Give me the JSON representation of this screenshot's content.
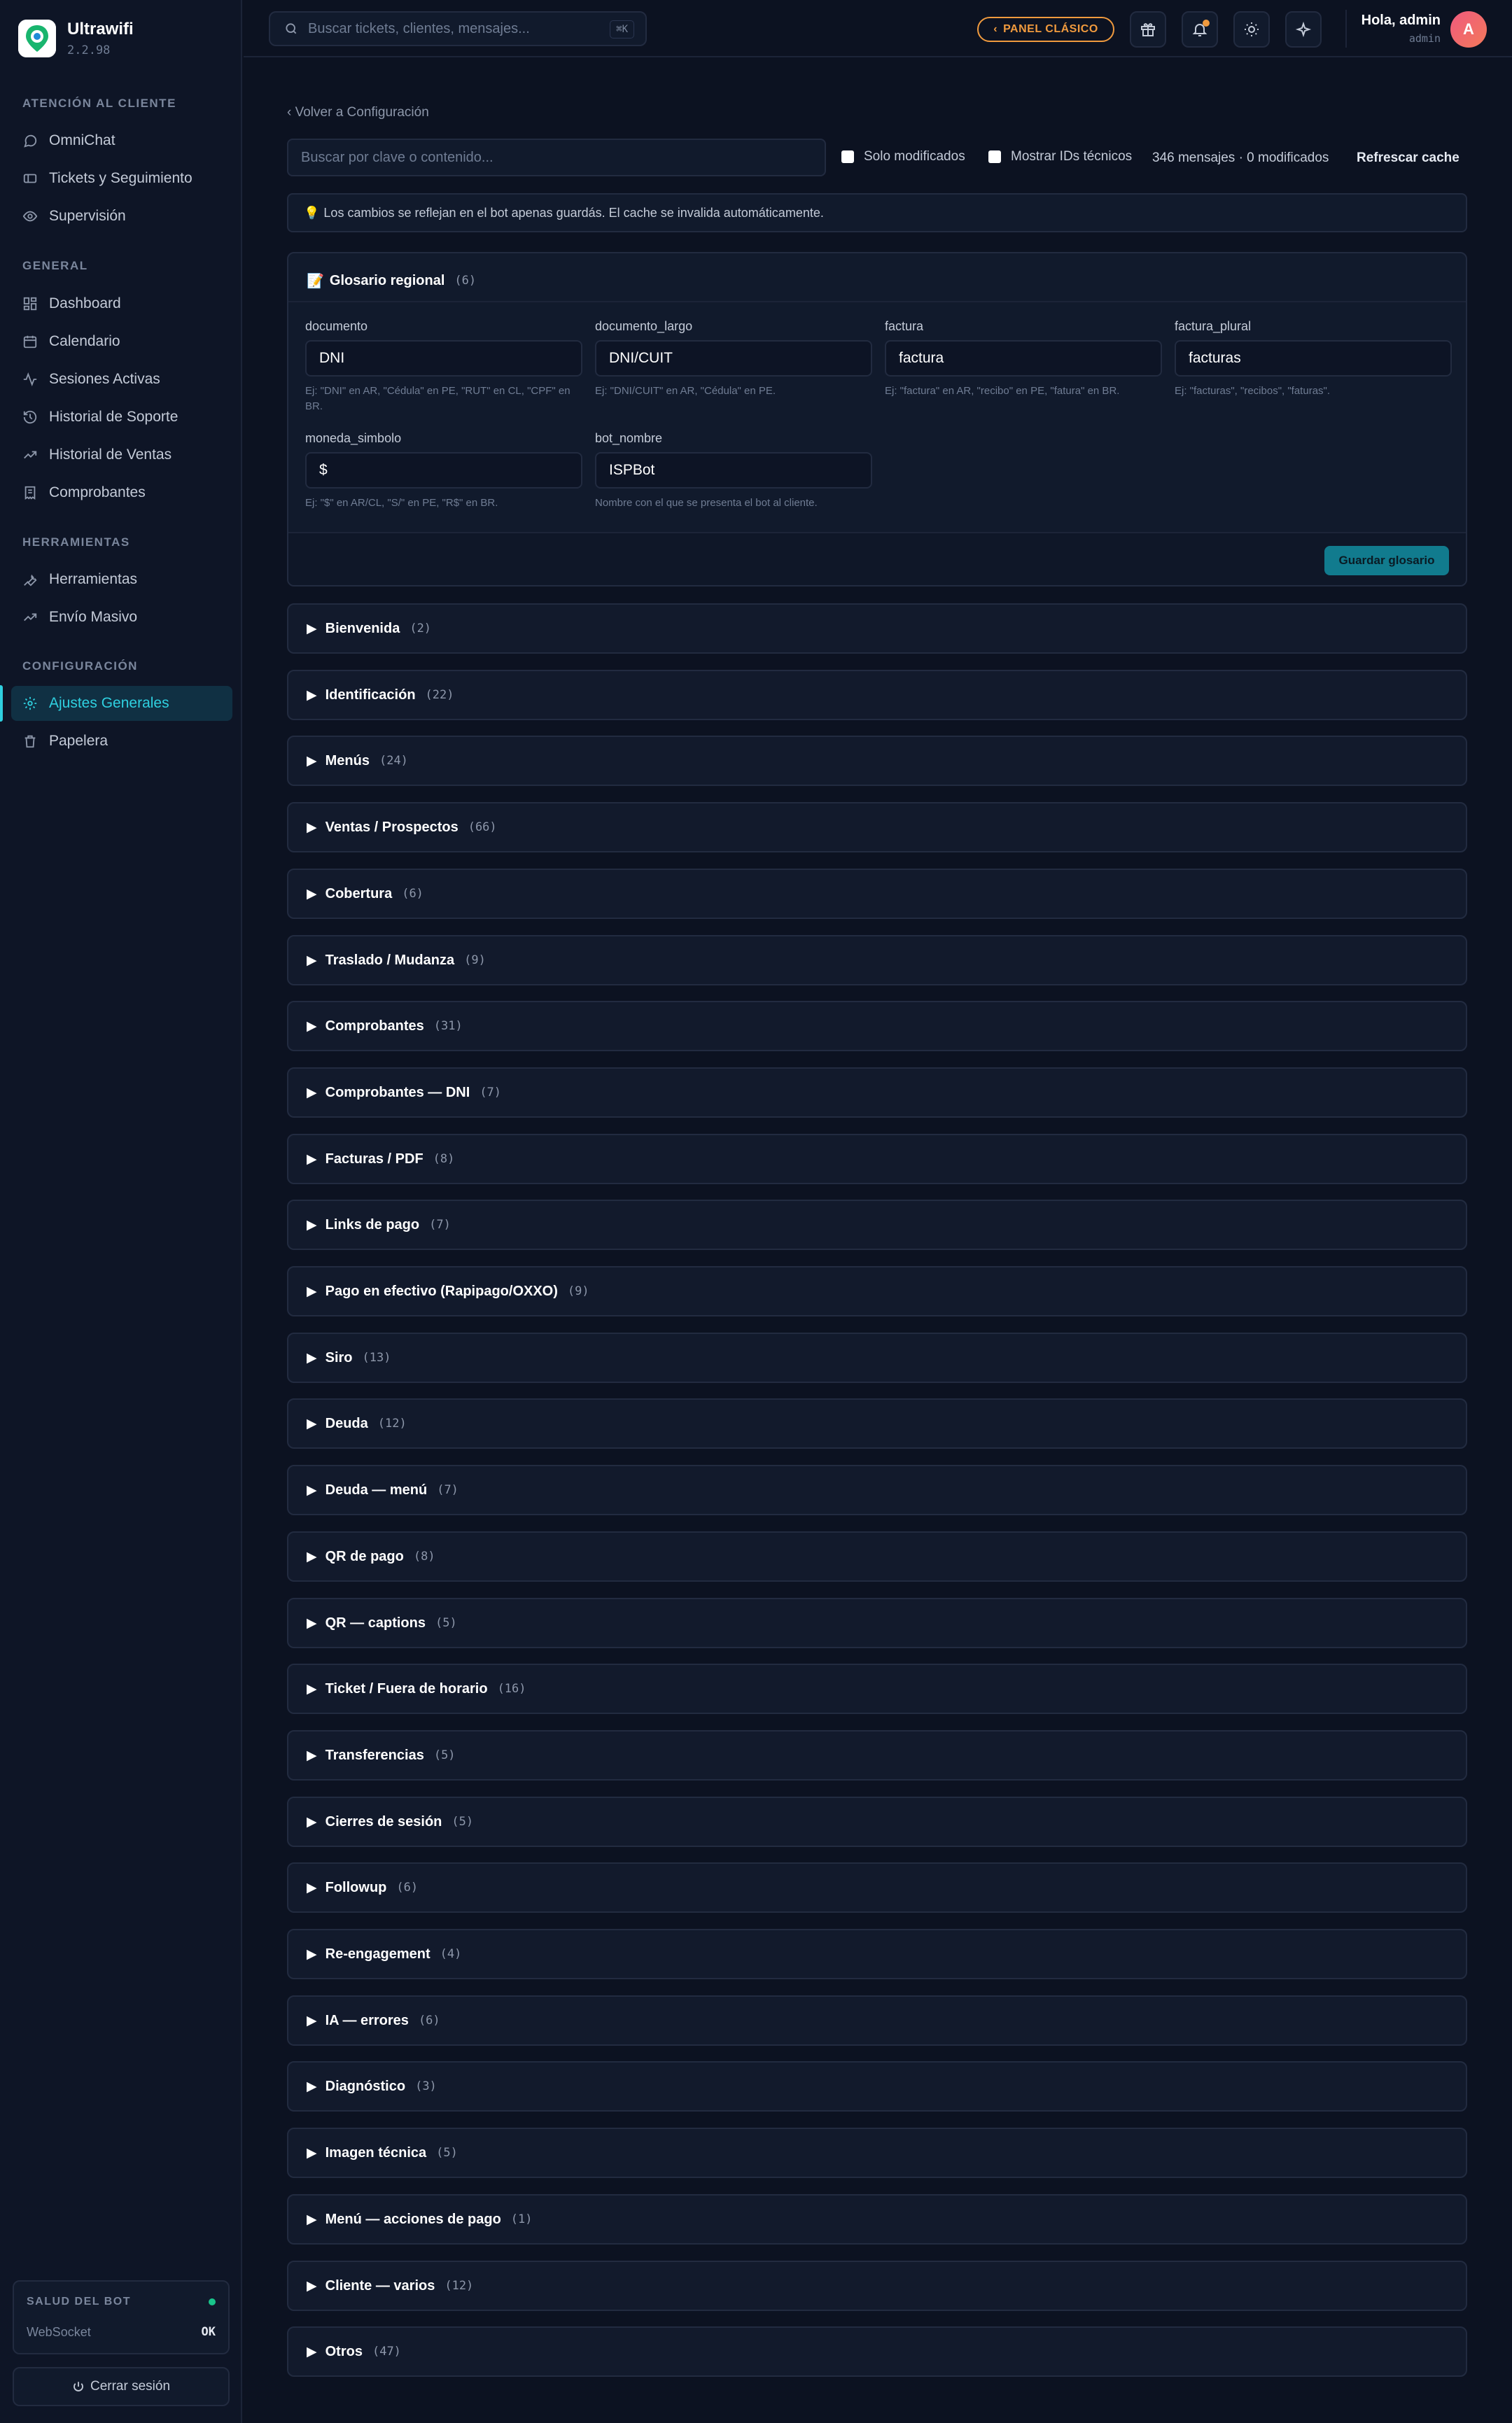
{
  "brand": {
    "name": "Ultrawifi",
    "version": "2.2.98"
  },
  "sidebar": {
    "sections": [
      {
        "title": "Atención al cliente",
        "items": [
          {
            "label": "OmniChat",
            "icon": "chat-icon"
          },
          {
            "label": "Tickets y Seguimiento",
            "icon": "ticket-icon"
          },
          {
            "label": "Supervisión",
            "icon": "eye-icon"
          }
        ]
      },
      {
        "title": "General",
        "items": [
          {
            "label": "Dashboard",
            "icon": "dashboard-icon"
          },
          {
            "label": "Calendario",
            "icon": "calendar-icon"
          },
          {
            "label": "Sesiones Activas",
            "icon": "activity-icon"
          },
          {
            "label": "Historial de Soporte",
            "icon": "history-icon"
          },
          {
            "label": "Historial de Ventas",
            "icon": "trend-icon"
          },
          {
            "label": "Comprobantes",
            "icon": "receipt-icon"
          }
        ]
      },
      {
        "title": "Herramientas",
        "items": [
          {
            "label": "Herramientas",
            "icon": "wrench-icon"
          },
          {
            "label": "Envío Masivo",
            "icon": "trend-icon"
          }
        ]
      },
      {
        "title": "Configuración",
        "items": [
          {
            "label": "Ajustes Generales",
            "icon": "gear-icon",
            "active": true
          },
          {
            "label": "Papelera",
            "icon": "trash-icon"
          }
        ]
      }
    ],
    "health": {
      "title": "SALUD DEL BOT",
      "ws_label": "WebSocket",
      "ws_status": "OK",
      "status_color": "#19c58b"
    },
    "logout_label": "Cerrar sesión"
  },
  "topbar": {
    "search_placeholder": "Buscar tickets, clientes, mensajes...",
    "search_shortcut": "⌘K",
    "classic_label": "PANEL CLÁSICO",
    "greeting": "Hola, admin",
    "role": "admin",
    "avatar_initial": "A"
  },
  "main": {
    "back_label": "‹ Volver a Configuración",
    "filter_placeholder": "Buscar por clave o contenido...",
    "only_modified_label": "Solo modificados",
    "show_ids_label": "Mostrar IDs técnicos",
    "message_count": "346 mensajes · 0 modificados",
    "refresh_label": "Refrescar cache",
    "info_banner": "Los cambios se reflejan en el bot apenas guardás. El cache se invalida automáticamente.",
    "glossary": {
      "title": "Glosario regional",
      "count": "(6)",
      "save_label": "Guardar glosario",
      "fields": [
        {
          "key": "documento",
          "value": "DNI",
          "hint": "Ej: \"DNI\" en AR, \"Cédula\" en PE, \"RUT\" en CL, \"CPF\" en BR."
        },
        {
          "key": "documento_largo",
          "value": "DNI/CUIT",
          "hint": "Ej: \"DNI/CUIT\" en AR, \"Cédula\" en PE."
        },
        {
          "key": "factura",
          "value": "factura",
          "hint": "Ej: \"factura\" en AR, \"recibo\" en PE, \"fatura\" en BR."
        },
        {
          "key": "factura_plural",
          "value": "facturas",
          "hint": "Ej: \"facturas\", \"recibos\", \"faturas\"."
        },
        {
          "key": "moneda_simbolo",
          "value": "$",
          "hint": "Ej: \"$\" en AR/CL, \"S/\" en PE, \"R$\" en BR."
        },
        {
          "key": "bot_nombre",
          "value": "ISPBot",
          "hint": "Nombre con el que se presenta el bot al cliente."
        }
      ]
    },
    "sections": [
      {
        "label": "Bienvenida",
        "count": "(2)"
      },
      {
        "label": "Identificación",
        "count": "(22)"
      },
      {
        "label": "Menús",
        "count": "(24)"
      },
      {
        "label": "Ventas / Prospectos",
        "count": "(66)"
      },
      {
        "label": "Cobertura",
        "count": "(6)"
      },
      {
        "label": "Traslado / Mudanza",
        "count": "(9)"
      },
      {
        "label": "Comprobantes",
        "count": "(31)"
      },
      {
        "label": "Comprobantes — DNI",
        "count": "(7)"
      },
      {
        "label": "Facturas / PDF",
        "count": "(8)"
      },
      {
        "label": "Links de pago",
        "count": "(7)"
      },
      {
        "label": "Pago en efectivo (Rapipago/OXXO)",
        "count": "(9)"
      },
      {
        "label": "Siro",
        "count": "(13)"
      },
      {
        "label": "Deuda",
        "count": "(12)"
      },
      {
        "label": "Deuda — menú",
        "count": "(7)"
      },
      {
        "label": "QR de pago",
        "count": "(8)"
      },
      {
        "label": "QR — captions",
        "count": "(5)"
      },
      {
        "label": "Ticket / Fuera de horario",
        "count": "(16)"
      },
      {
        "label": "Transferencias",
        "count": "(5)"
      },
      {
        "label": "Cierres de sesión",
        "count": "(5)"
      },
      {
        "label": "Followup",
        "count": "(6)"
      },
      {
        "label": "Re-engagement",
        "count": "(4)"
      },
      {
        "label": "IA — errores",
        "count": "(6)"
      },
      {
        "label": "Diagnóstico",
        "count": "(3)"
      },
      {
        "label": "Imagen técnica",
        "count": "(5)"
      },
      {
        "label": "Menú — acciones de pago",
        "count": "(1)"
      },
      {
        "label": "Cliente — varios",
        "count": "(12)"
      },
      {
        "label": "Otros",
        "count": "(47)"
      }
    ]
  },
  "colors": {
    "accent": "#2fd0e0",
    "warning": "#f09a3e",
    "save_button": "#117b8e",
    "background": "#0c1221"
  }
}
